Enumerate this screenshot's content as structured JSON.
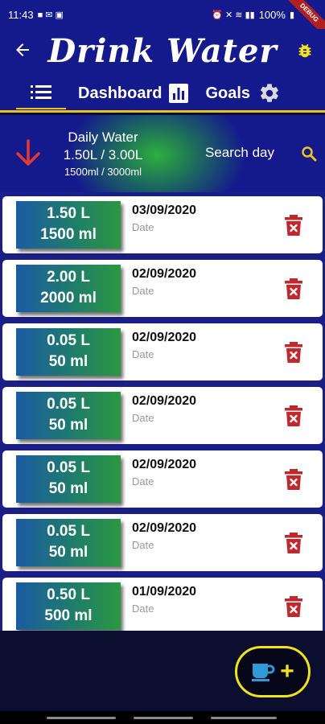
{
  "status_bar": {
    "time": "11:43",
    "battery": "100%",
    "debug_label": "DEBUG"
  },
  "app_bar": {
    "title": "Drink Water"
  },
  "tabs": {
    "dashboard_label": "Dashboard",
    "goals_label": "Goals"
  },
  "summary": {
    "title": "Daily Water",
    "liters": "1.50L / 3.00L",
    "milliliters": "1500ml / 3000ml",
    "search_label": "Search day"
  },
  "entries": [
    {
      "liters": "1.50 L",
      "ml": "1500 ml",
      "date": "03/09/2020",
      "date_label": "Date"
    },
    {
      "liters": "2.00 L",
      "ml": "2000 ml",
      "date": "02/09/2020",
      "date_label": "Date"
    },
    {
      "liters": "0.05 L",
      "ml": "50 ml",
      "date": "02/09/2020",
      "date_label": "Date"
    },
    {
      "liters": "0.05 L",
      "ml": "50 ml",
      "date": "02/09/2020",
      "date_label": "Date"
    },
    {
      "liters": "0.05 L",
      "ml": "50 ml",
      "date": "02/09/2020",
      "date_label": "Date"
    },
    {
      "liters": "0.05 L",
      "ml": "50 ml",
      "date": "02/09/2020",
      "date_label": "Date"
    },
    {
      "liters": "0.50 L",
      "ml": "500 ml",
      "date": "01/09/2020",
      "date_label": "Date"
    }
  ],
  "fab": {
    "plus": "+"
  },
  "colors": {
    "app_bar": "#141a8c",
    "accent_yellow": "#e6c429",
    "delete_red": "#c0282e",
    "arrow_red": "#e43a2e",
    "badge_blue": "#1c5aa3",
    "badge_green": "#2b9742"
  },
  "icons": {
    "back": "back-arrow-icon",
    "bug": "bug-icon",
    "list": "list-icon",
    "chart": "bar-chart-icon",
    "settings": "gear-icon",
    "down_arrow": "arrow-down-icon",
    "search": "search-icon",
    "delete": "trash-icon",
    "coffee": "coffee-cup-icon"
  }
}
